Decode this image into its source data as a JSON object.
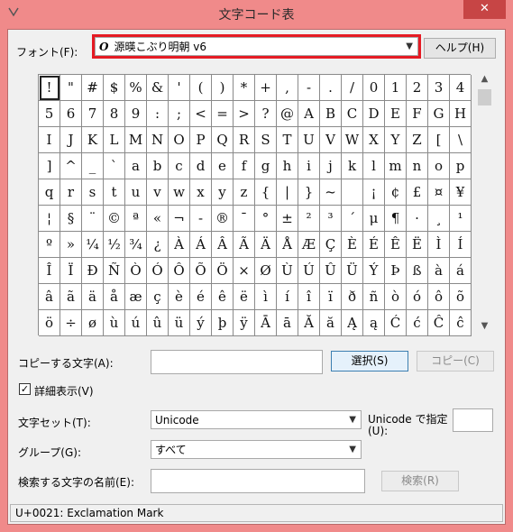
{
  "window": {
    "title": "文字コード表",
    "close_glyph": "✕"
  },
  "font_row": {
    "label": "フォント(F):",
    "font_glyph": "O",
    "value": "源暎こぶり明朝 v6",
    "help_button": "ヘルプ(H)"
  },
  "grid": {
    "rows": [
      [
        "!",
        "\"",
        "#",
        "$",
        "%",
        "&",
        "'",
        "(",
        ")",
        "*",
        "+",
        ",",
        "-",
        ".",
        "/",
        "0",
        "1",
        "2",
        "3",
        "4"
      ],
      [
        "5",
        "6",
        "7",
        "8",
        "9",
        ":",
        ";",
        "<",
        "=",
        ">",
        "?",
        "@",
        "A",
        "B",
        "C",
        "D",
        "E",
        "F",
        "G",
        "H"
      ],
      [
        "I",
        "J",
        "K",
        "L",
        "M",
        "N",
        "O",
        "P",
        "Q",
        "R",
        "S",
        "T",
        "U",
        "V",
        "W",
        "X",
        "Y",
        "Z",
        "[",
        "\\"
      ],
      [
        "]",
        "^",
        "_",
        "`",
        "a",
        "b",
        "c",
        "d",
        "e",
        "f",
        "g",
        "h",
        "i",
        "j",
        "k",
        "l",
        "m",
        "n",
        "o",
        "p"
      ],
      [
        "q",
        "r",
        "s",
        "t",
        "u",
        "v",
        "w",
        "x",
        "y",
        "z",
        "{",
        "|",
        "}",
        "~",
        " ",
        "¡",
        "¢",
        "£",
        "¤",
        "¥"
      ],
      [
        "¦",
        "§",
        "¨",
        "©",
        "ª",
        "«",
        "¬",
        "-",
        "®",
        "¯",
        "°",
        "±",
        "²",
        "³",
        "´",
        "μ",
        "¶",
        "·",
        "¸",
        "¹"
      ],
      [
        "º",
        "»",
        "¼",
        "½",
        "¾",
        "¿",
        "À",
        "Á",
        "Â",
        "Ã",
        "Ä",
        "Å",
        "Æ",
        "Ç",
        "È",
        "É",
        "Ê",
        "Ë",
        "Ì",
        "Í"
      ],
      [
        "Î",
        "Ï",
        "Ð",
        "Ñ",
        "Ò",
        "Ó",
        "Ô",
        "Õ",
        "Ö",
        "×",
        "Ø",
        "Ù",
        "Ú",
        "Û",
        "Ü",
        "Ý",
        "Þ",
        "ß",
        "à",
        "á"
      ],
      [
        "â",
        "ã",
        "ä",
        "å",
        "æ",
        "ç",
        "è",
        "é",
        "ê",
        "ë",
        "ì",
        "í",
        "î",
        "ï",
        "ð",
        "ñ",
        "ò",
        "ó",
        "ô",
        "õ"
      ],
      [
        "ö",
        "÷",
        "ø",
        "ù",
        "ú",
        "û",
        "ü",
        "ý",
        "þ",
        "ÿ",
        "Ā",
        "ā",
        "Ă",
        "ă",
        "Ą",
        "ą",
        "Ć",
        "ć",
        "Ĉ",
        "ĉ"
      ]
    ],
    "selected_char": "!"
  },
  "copy_row": {
    "label": "コピーする文字(A):",
    "value": "",
    "select_button": "選択(S)",
    "copy_button": "コピー(C)"
  },
  "advanced": {
    "label": "詳細表示(V)",
    "checked": true,
    "check_glyph": "✓"
  },
  "charset": {
    "label": "文字セット(T):",
    "value": "Unicode",
    "unicode_label_line1": "Unicode で指定",
    "unicode_label_line2": "(U):",
    "unicode_value": ""
  },
  "group": {
    "label": "グループ(G):",
    "value": "すべて"
  },
  "search": {
    "label": "検索する文字の名前(E):",
    "value": "",
    "button": "検索(R)"
  },
  "status": {
    "text": "U+0021: Exclamation Mark"
  },
  "icons": {
    "dropdown": "chevron-down-icon",
    "scroll_up": "scroll-up-icon",
    "scroll_down": "scroll-down-icon"
  },
  "colors": {
    "frame": "#f08a8a",
    "close": "#c74545",
    "highlight": "#e51b24"
  }
}
